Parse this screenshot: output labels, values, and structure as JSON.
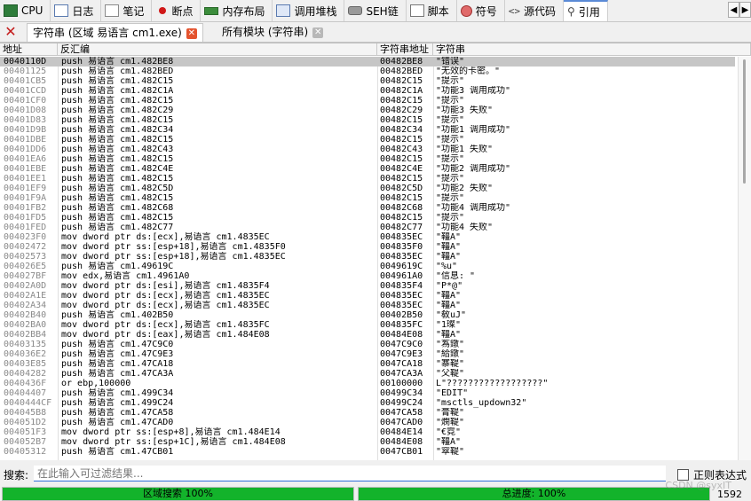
{
  "tabs": [
    {
      "label": "CPU",
      "icon": "cpu-icon"
    },
    {
      "label": "日志",
      "icon": "log-icon"
    },
    {
      "label": "笔记",
      "icon": "notes-icon"
    },
    {
      "label": "断点",
      "icon": "breakpoint-icon"
    },
    {
      "label": "内存布局",
      "icon": "memory-map-icon"
    },
    {
      "label": "调用堆栈",
      "icon": "call-stack-icon"
    },
    {
      "label": "SEH链",
      "icon": "seh-icon"
    },
    {
      "label": "脚本",
      "icon": "script-icon"
    },
    {
      "label": "符号",
      "icon": "symbol-icon"
    },
    {
      "label": "源代码",
      "icon": "source-icon"
    },
    {
      "label": "引用",
      "icon": "reference-icon"
    }
  ],
  "active_tab": "引用",
  "nav": {
    "left": "◀",
    "right": "▶"
  },
  "subtabs": [
    {
      "label": "字符串 (区域 易语言 cm1.exe)",
      "close": "✕"
    },
    {
      "label": "所有模块 (字符串)",
      "close": "✕"
    }
  ],
  "columns": {
    "address": "地址",
    "disasm": "反汇编",
    "string_address": "字符串地址",
    "string": "字符串"
  },
  "rows": [
    {
      "addr": "0040110D",
      "dis": "push 易语言 cm1.482BE8",
      "saddr": "00482BE8",
      "str": "\"错误\""
    },
    {
      "addr": "00401125",
      "dis": "push 易语言 cm1.482BED",
      "saddr": "00482BED",
      "str": "\"无效的卡密。\""
    },
    {
      "addr": "00401CB5",
      "dis": "push 易语言 cm1.482C15",
      "saddr": "00482C15",
      "str": "\"提示\""
    },
    {
      "addr": "00401CCD",
      "dis": "push 易语言 cm1.482C1A",
      "saddr": "00482C1A",
      "str": "\"功能3 调用成功\""
    },
    {
      "addr": "00401CF0",
      "dis": "push 易语言 cm1.482C15",
      "saddr": "00482C15",
      "str": "\"提示\""
    },
    {
      "addr": "00401D08",
      "dis": "push 易语言 cm1.482C29",
      "saddr": "00482C29",
      "str": "\"功能3 失败\""
    },
    {
      "addr": "00401D83",
      "dis": "push 易语言 cm1.482C15",
      "saddr": "00482C15",
      "str": "\"提示\""
    },
    {
      "addr": "00401D9B",
      "dis": "push 易语言 cm1.482C34",
      "saddr": "00482C34",
      "str": "\"功能1 调用成功\""
    },
    {
      "addr": "00401DBE",
      "dis": "push 易语言 cm1.482C15",
      "saddr": "00482C15",
      "str": "\"提示\""
    },
    {
      "addr": "00401DD6",
      "dis": "push 易语言 cm1.482C43",
      "saddr": "00482C43",
      "str": "\"功能1 失败\""
    },
    {
      "addr": "00401EA6",
      "dis": "push 易语言 cm1.482C15",
      "saddr": "00482C15",
      "str": "\"提示\""
    },
    {
      "addr": "00401EBE",
      "dis": "push 易语言 cm1.482C4E",
      "saddr": "00482C4E",
      "str": "\"功能2 调用成功\""
    },
    {
      "addr": "00401EE1",
      "dis": "push 易语言 cm1.482C15",
      "saddr": "00482C15",
      "str": "\"提示\""
    },
    {
      "addr": "00401EF9",
      "dis": "push 易语言 cm1.482C5D",
      "saddr": "00482C5D",
      "str": "\"功能2 失败\""
    },
    {
      "addr": "00401F9A",
      "dis": "push 易语言 cm1.482C15",
      "saddr": "00482C15",
      "str": "\"提示\""
    },
    {
      "addr": "00401FB2",
      "dis": "push 易语言 cm1.482C68",
      "saddr": "00482C68",
      "str": "\"功能4 调用成功\""
    },
    {
      "addr": "00401FD5",
      "dis": "push 易语言 cm1.482C15",
      "saddr": "00482C15",
      "str": "\"提示\""
    },
    {
      "addr": "00401FED",
      "dis": "push 易语言 cm1.482C77",
      "saddr": "00482C77",
      "str": "\"功能4 失败\""
    },
    {
      "addr": "004023F0",
      "dis": "mov dword ptr ds:[ecx],易语言 cm1.4835EC",
      "saddr": "004835EC",
      "str": "\"韁A\""
    },
    {
      "addr": "00402472",
      "dis": "mov dword ptr ss:[esp+18],易语言 cm1.4835F0",
      "saddr": "004835F0",
      "str": "\"韁A\""
    },
    {
      "addr": "00402573",
      "dis": "mov dword ptr ss:[esp+18],易语言 cm1.4835EC",
      "saddr": "004835EC",
      "str": "\"韁A\""
    },
    {
      "addr": "004026E5",
      "dis": "push 易语言 cm1.49619C",
      "saddr": "0049619C",
      "str": "\"%u\""
    },
    {
      "addr": "004027BF",
      "dis": "mov edx,易语言 cm1.4961A0",
      "saddr": "004961A0",
      "str": "\"信息: \""
    },
    {
      "addr": "00402A0D",
      "dis": "mov dword ptr ds:[esi],易语言 cm1.4835F4",
      "saddr": "004835F4",
      "str": "\"P*@\""
    },
    {
      "addr": "00402A1E",
      "dis": "mov dword ptr ds:[ecx],易语言 cm1.4835EC",
      "saddr": "004835EC",
      "str": "\"韁A\""
    },
    {
      "addr": "00402A34",
      "dis": "mov dword ptr ds:[ecx],易语言 cm1.4835EC",
      "saddr": "004835EC",
      "str": "\"韁A\""
    },
    {
      "addr": "00402B40",
      "dis": "push 易语言 cm1.402B50",
      "saddr": "00402B50",
      "str": "\"敎uJ\""
    },
    {
      "addr": "00402BA0",
      "dis": "mov dword ptr ds:[ecx],易语言 cm1.4835FC",
      "saddr": "004835FC",
      "str": "\"1璨\""
    },
    {
      "addr": "00402BB4",
      "dis": "mov dword ptr ds:[eax],易语言 cm1.484E08",
      "saddr": "00484E08",
      "str": "\"韁A\""
    },
    {
      "addr": "00403135",
      "dis": "push 易语言 cm1.47C9C0",
      "saddr": "0047C9C0",
      "str": "\"蒍鐓\""
    },
    {
      "addr": "004036E2",
      "dis": "push 易语言 cm1.47C9E3",
      "saddr": "0047C9E3",
      "str": "\"給鐓\""
    },
    {
      "addr": "00403E85",
      "dis": "push 易语言 cm1.47CA18",
      "saddr": "0047CA18",
      "str": "\"寨鞮\""
    },
    {
      "addr": "00404282",
      "dis": "push 易语言 cm1.47CA3A",
      "saddr": "0047CA3A",
      "str": "\"父鞮\""
    },
    {
      "addr": "0040436F",
      "dis": "or ebp,100000",
      "saddr": "00100000",
      "str": "L\"??????????????????\""
    },
    {
      "addr": "00404407",
      "dis": "push 易语言 cm1.499C34",
      "saddr": "00499C34",
      "str": "\"EDIT\""
    },
    {
      "addr": "0040444CF",
      "dis": "push 易语言 cm1.499C24",
      "saddr": "00499C24",
      "str": "\"msctls_updown32\""
    },
    {
      "addr": "004045B8",
      "dis": "push 易语言 cm1.47CA58",
      "saddr": "0047CA58",
      "str": "\"膏鞮\""
    },
    {
      "addr": "004051D2",
      "dis": "push 易语言 cm1.47CAD0",
      "saddr": "0047CAD0",
      "str": "\"燘鞮\""
    },
    {
      "addr": "004051F3",
      "dis": "mov dword ptr ss:[esp+8],易语言 cm1.484E14",
      "saddr": "00484E14",
      "str": "\"€霓\""
    },
    {
      "addr": "004052B7",
      "dis": "mov dword ptr ss:[esp+1C],易语言 cm1.484E08",
      "saddr": "00484E08",
      "str": "\"韁A\""
    },
    {
      "addr": "00405312",
      "dis": "push 易语言 cm1.47CB01",
      "saddr": "0047CB01",
      "str": "\"窣鞮\""
    }
  ],
  "search": {
    "label": "搜索:",
    "placeholder": "在此输入可过滤结果..."
  },
  "regex_label": "正则表达式",
  "progress": {
    "region": {
      "label": "区域搜索 100%",
      "value": 1.0
    },
    "total": {
      "label": "总进度: 100%",
      "value": 1.0
    }
  },
  "count": "1592",
  "watermark": "CSDN @syxIT",
  "colors": {
    "progress_fill": "#13b32b",
    "selected_row": "#c6c6c6",
    "close_red": "#e4532e",
    "active_tab_border": "#5a8ad6"
  }
}
